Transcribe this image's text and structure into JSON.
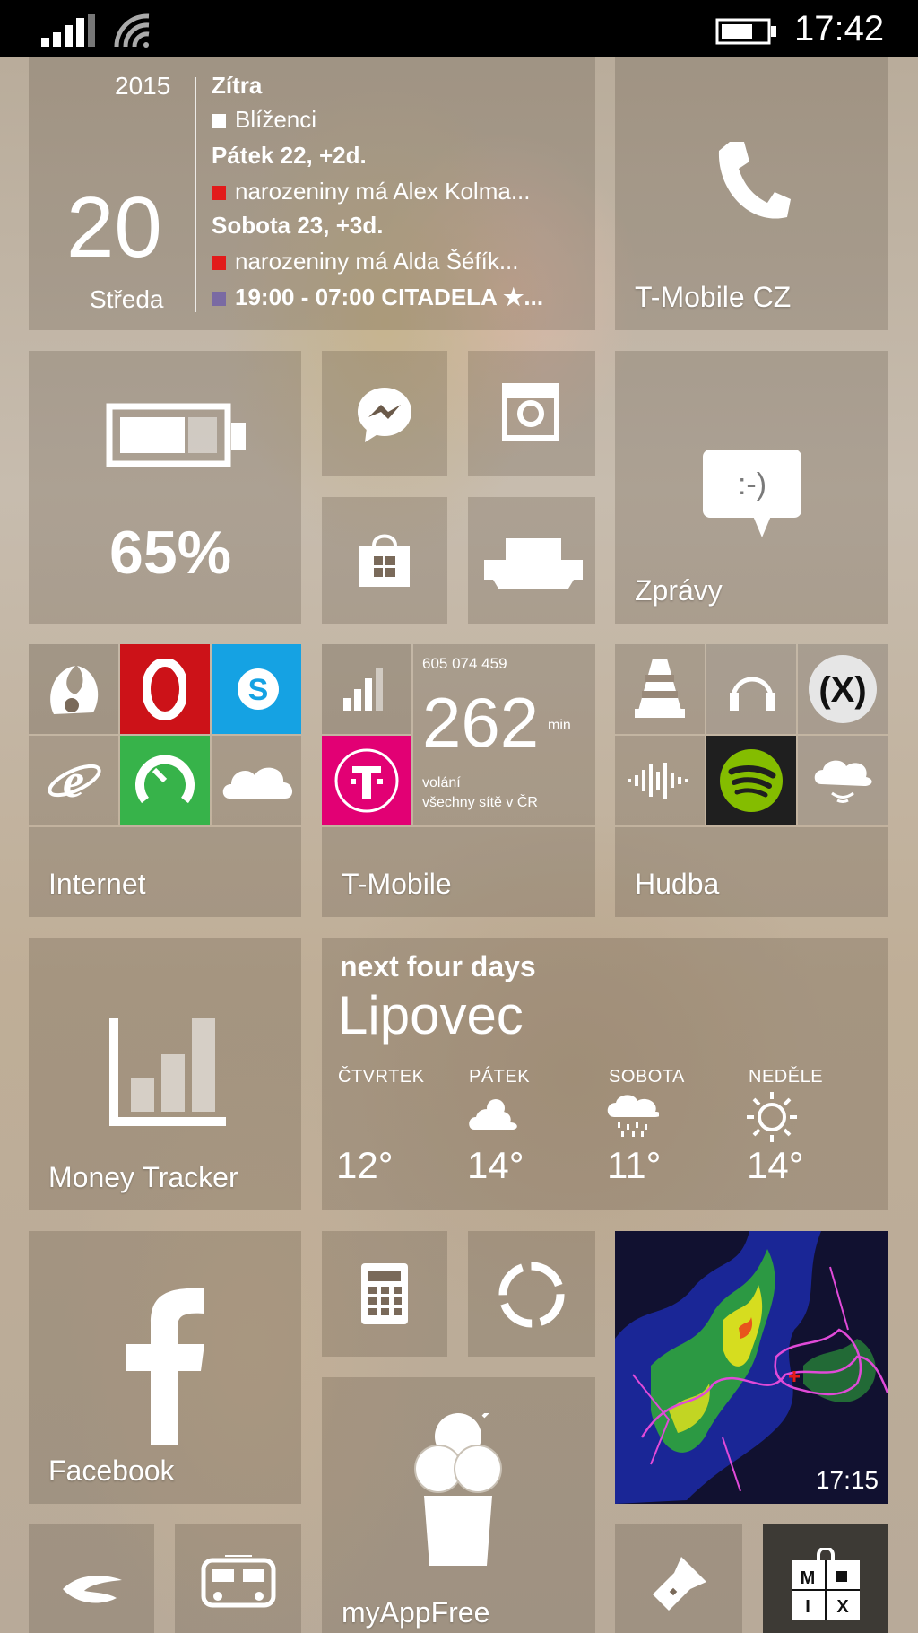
{
  "status_bar": {
    "time": "17:42",
    "signal_icon": "signal-bars-icon",
    "wifi_icon": "wifi-icon",
    "battery_icon": "battery-icon"
  },
  "calendar": {
    "year": "2015",
    "day": "20",
    "weekday": "Středa",
    "events": [
      {
        "text": "Zítra",
        "type": "header"
      },
      {
        "text": "Blíženci",
        "marker_color": "#ffffff"
      },
      {
        "text": "Pátek 22, +2d.",
        "type": "header"
      },
      {
        "text": "narozeniny má Alex Kolma...",
        "marker_color": "#e21b1b"
      },
      {
        "text": "Sobota 23, +3d.",
        "type": "header"
      },
      {
        "text": "narozeniny má Alda Šéfík...",
        "marker_color": "#e21b1b"
      },
      {
        "text": "19:00 - 07:00 CITADELA ★...",
        "marker_color": "#7a6aa3"
      }
    ]
  },
  "tiles": {
    "phone": {
      "label": "T-Mobile CZ",
      "icon": "phone-icon"
    },
    "battery": {
      "value": "65%",
      "icon": "battery-icon",
      "level": 0.65
    },
    "messenger": {
      "icon": "messenger-icon"
    },
    "instagram": {
      "icon": "camera-icon"
    },
    "store": {
      "icon": "store-icon"
    },
    "lounge": {
      "icon": "sofa-icon"
    },
    "messaging": {
      "label": "Zprávy",
      "icon": "smiley-message-icon",
      "glyph": ":-)"
    },
    "internet": {
      "label": "Internet",
      "apps": [
        {
          "icon": "uc-browser-icon",
          "bg": ""
        },
        {
          "icon": "opera-icon",
          "bg": "#cc1218"
        },
        {
          "icon": "skype-icon",
          "bg": "#15a2e3"
        },
        {
          "icon": "internet-explorer-icon",
          "bg": ""
        },
        {
          "icon": "speedometer-icon",
          "bg": "#37b34a"
        },
        {
          "icon": "onedrive-icon",
          "bg": ""
        }
      ]
    },
    "tmobile": {
      "label": "T-Mobile",
      "number": "605 074 459",
      "minutes": "262",
      "unit": "min",
      "line1": "volání",
      "line2": "všechny sítě v ČR",
      "brand_color": "#e20074"
    },
    "music": {
      "label": "Hudba",
      "apps": [
        {
          "icon": "vlc-icon"
        },
        {
          "icon": "headphones-icon"
        },
        {
          "icon": "xbox-music-icon"
        },
        {
          "icon": "audio-wave-icon"
        },
        {
          "icon": "spotify-icon",
          "bg": "#1f1f1f"
        },
        {
          "icon": "cloud-audio-icon"
        }
      ]
    },
    "money": {
      "label": "Money Tracker",
      "icon": "bar-chart-icon"
    },
    "weather": {
      "title": "next four days",
      "city": "Lipovec",
      "days": [
        {
          "name": "ČTVRTEK",
          "temp": "12°",
          "icon": ""
        },
        {
          "name": "PÁTEK",
          "temp": "14°",
          "icon": "partly-cloudy-icon"
        },
        {
          "name": "SOBOTA",
          "temp": "11°",
          "icon": "rain-icon"
        },
        {
          "name": "NEDĚLE",
          "temp": "14°",
          "icon": "sun-icon"
        }
      ]
    },
    "facebook": {
      "label": "Facebook",
      "icon": "facebook-icon"
    },
    "calculator": {
      "icon": "calculator-icon"
    },
    "timer": {
      "icon": "ring-icon"
    },
    "radar": {
      "time": "17:15"
    },
    "myappfree": {
      "label": "myAppFree",
      "icon": "ice-cream-icon"
    },
    "airline": {
      "icon": "airline-icon"
    },
    "transit": {
      "icon": "bus-tram-icon"
    },
    "flashlight": {
      "icon": "flashlight-icon"
    },
    "mix": {
      "letters": [
        "M",
        "I",
        "X"
      ],
      "icon": "lock-icon"
    }
  }
}
